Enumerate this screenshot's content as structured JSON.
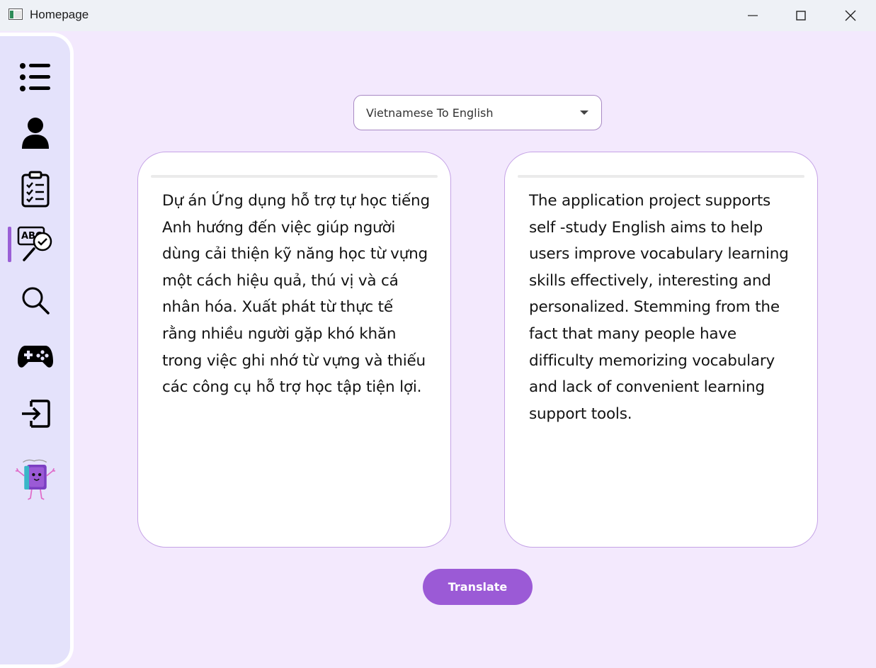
{
  "window": {
    "title": "Homepage"
  },
  "sidebar": {
    "items": [
      {
        "name": "list-icon"
      },
      {
        "name": "user-icon"
      },
      {
        "name": "clipboard-checklist-icon"
      },
      {
        "name": "spell-check-icon",
        "active": true
      },
      {
        "name": "search-icon"
      },
      {
        "name": "gamepad-icon"
      },
      {
        "name": "logout-icon"
      },
      {
        "name": "book-mascot-icon"
      }
    ]
  },
  "translator": {
    "direction": "Vietnamese To English",
    "source_text": "Dự án Ứng dụng hỗ trợ tự học tiếng Anh hướng đến việc giúp người dùng cải thiện kỹ năng học từ vựng một cách hiệu quả, thú vị và cá nhân hóa. Xuất phát từ thực tế rằng nhiều người gặp khó khăn trong việc ghi nhớ từ vựng và thiếu các công cụ hỗ trợ học tập tiện lợi.",
    "translated_text": "The application project supports self -study English aims to help users improve vocabulary learning skills effectively, interesting and personalized. Stemming from the fact that many people have difficulty memorizing vocabulary and lack of convenient learning support tools.",
    "translate_label": "Translate"
  },
  "colors": {
    "accent": "#9b5ad6",
    "background": "#f3e9fd",
    "sidebar": "#e4e2fb",
    "card_border": "#c5a3e6"
  }
}
